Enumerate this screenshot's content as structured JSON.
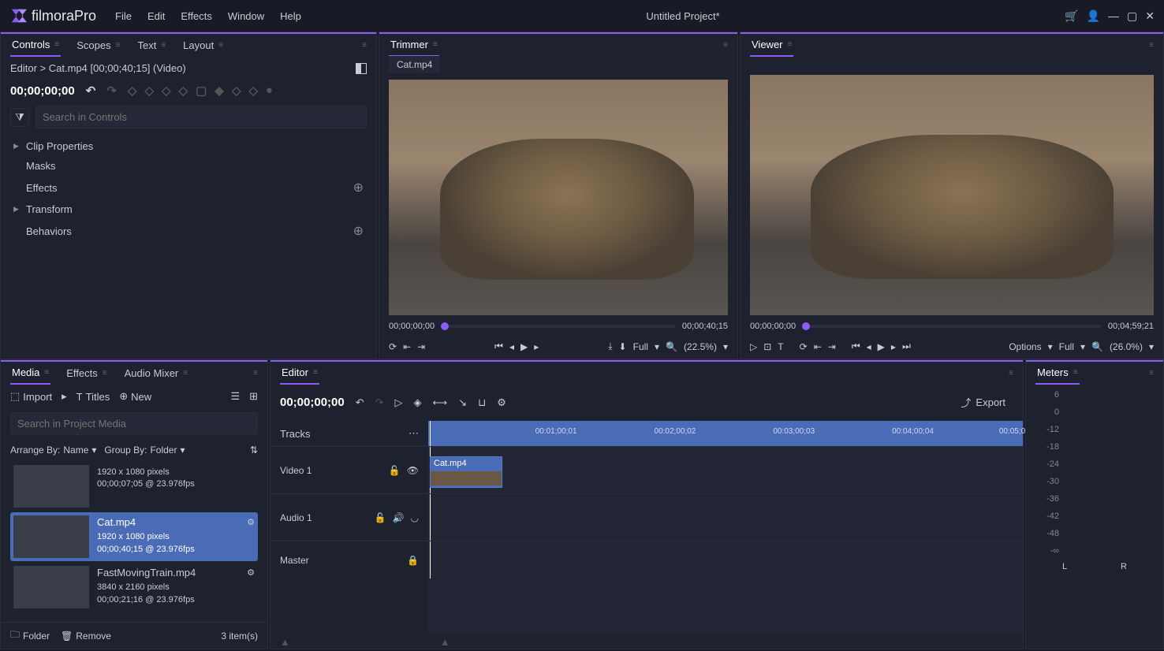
{
  "app": {
    "name": "filmoraPro",
    "project_title": "Untitled Project*"
  },
  "menu": [
    "File",
    "Edit",
    "Effects",
    "Window",
    "Help"
  ],
  "panels": {
    "controls": "Controls",
    "scopes": "Scopes",
    "text": "Text",
    "layout": "Layout",
    "trimmer": "Trimmer",
    "viewer": "Viewer",
    "media": "Media",
    "effects": "Effects",
    "audio_mixer": "Audio Mixer",
    "editor": "Editor",
    "meters": "Meters"
  },
  "controls": {
    "breadcrumb": "Editor > Cat.mp4 [00;00;40;15] (Video)",
    "timecode": "00;00;00;00",
    "search_placeholder": "Search in Controls",
    "items": [
      {
        "label": "Clip Properties",
        "caret": true,
        "add": false
      },
      {
        "label": "Masks",
        "caret": false,
        "add": false
      },
      {
        "label": "Effects",
        "caret": false,
        "add": true
      },
      {
        "label": "Transform",
        "caret": true,
        "add": false
      },
      {
        "label": "Behaviors",
        "caret": false,
        "add": true
      }
    ]
  },
  "trimmer": {
    "clip": "Cat.mp4",
    "time_start": "00;00;00;00",
    "time_end": "00;00;40;15",
    "scale_label": "Full",
    "zoom": "(22.5%)"
  },
  "viewer": {
    "time_start": "00;00;00;00",
    "time_end": "00;04;59;21",
    "options": "Options",
    "scale_label": "Full",
    "zoom": "(26.0%)"
  },
  "media": {
    "import": "Import",
    "titles": "Titles",
    "new": "New",
    "search_placeholder": "Search in Project Media",
    "arrange_label": "Arrange By:",
    "arrange_value": "Name",
    "group_label": "Group By:",
    "group_value": "Folder",
    "items": [
      {
        "name": "",
        "res": "1920 x 1080 pixels",
        "meta": "00;00;07;05 @ 23.976fps",
        "selected": false,
        "gear": false
      },
      {
        "name": "Cat.mp4",
        "res": "1920 x 1080 pixels",
        "meta": "00;00;40;15 @ 23.976fps",
        "selected": true,
        "gear": true
      },
      {
        "name": "FastMovingTrain.mp4",
        "res": "3840 x 2160 pixels",
        "meta": "00;00;21;16 @ 23.976fps",
        "selected": false,
        "gear": true
      }
    ],
    "folder": "Folder",
    "remove": "Remove",
    "count": "3 item(s)"
  },
  "editor": {
    "timecode": "00;00;00;00",
    "export": "Export",
    "tracks_label": "Tracks",
    "tracks": [
      "Video 1",
      "Audio 1",
      "Master"
    ],
    "clip_name": "Cat.mp4",
    "ruler_marks": [
      "00:01;00;01",
      "00:02;00;02",
      "00:03;00;03",
      "00:04;00;04",
      "00:05;0"
    ]
  },
  "meters": {
    "scale": [
      "6",
      "0",
      "-12",
      "-18",
      "-24",
      "-30",
      "-36",
      "-42",
      "-48",
      "-∞"
    ],
    "channels": [
      "L",
      "R"
    ]
  }
}
